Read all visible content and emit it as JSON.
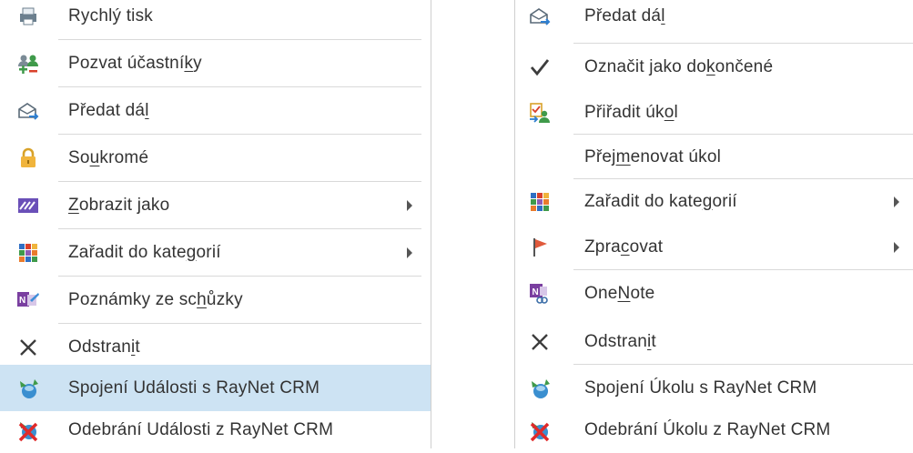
{
  "left_menu": {
    "items": [
      {
        "label_a": "Rychlý tisk",
        "icon": "printer-icon"
      },
      {
        "label_a": "Pozvat účastní",
        "label_u": "k",
        "label_b": "y",
        "icon": "invite-attendees-icon"
      },
      {
        "label_a": "Předat dá",
        "label_u": "l",
        "label_b": "",
        "icon": "forward-icon"
      },
      {
        "label_a": "So",
        "label_u": "u",
        "label_b": "kromé",
        "icon": "lock-icon"
      },
      {
        "label_a": "",
        "label_u": "Z",
        "label_b": "obrazit jako",
        "icon": "show-as-icon",
        "submenu": true
      },
      {
        "label_a": "Zařadit do kate",
        "label_u": "g",
        "label_b": "orií",
        "icon": "categorize-icon",
        "submenu": true
      },
      {
        "label_a": "Poznámky ze sc",
        "label_u": "h",
        "label_b": "ůzky",
        "icon": "onenote-meeting-notes-icon"
      },
      {
        "label_a": "Odstran",
        "label_u": "i",
        "label_b": "t",
        "icon": "delete-icon"
      },
      {
        "label_a": "Spojení Události s RayNet CRM",
        "icon": "raynet-link-icon",
        "highlight": true
      },
      {
        "label_a": "Odebrání Události z RayNet CRM",
        "icon": "raynet-unlink-icon"
      }
    ]
  },
  "right_menu": {
    "items": [
      {
        "label_a": "Předat dá",
        "label_u": "l",
        "label_b": "",
        "icon": "forward-icon"
      },
      {
        "label_a": "Označit jako do",
        "label_u": "k",
        "label_b": "ončené",
        "icon": "checkmark-icon"
      },
      {
        "label_a": "Přiřadit úk",
        "label_u": "o",
        "label_b": "l",
        "icon": "assign-task-icon"
      },
      {
        "label_a": "Přej",
        "label_u": "m",
        "label_b": "enovat úkol",
        "icon": ""
      },
      {
        "label_a": "Zařadit do kate",
        "label_u": "g",
        "label_b": "orií",
        "icon": "categorize-icon",
        "submenu": true
      },
      {
        "label_a": "Zpra",
        "label_u": "c",
        "label_b": "ovat",
        "icon": "flag-icon",
        "submenu": true
      },
      {
        "label_a": "One",
        "label_u": "N",
        "label_b": "ote",
        "icon": "onenote-icon"
      },
      {
        "label_a": "Odstran",
        "label_u": "i",
        "label_b": "t",
        "icon": "delete-icon"
      },
      {
        "label_a": "Spojení Úkolu s RayNet CRM",
        "icon": "raynet-link-icon"
      },
      {
        "label_a": "Odebrání Úkolu z RayNet CRM",
        "icon": "raynet-unlink-icon"
      }
    ]
  },
  "colors": {
    "highlight": "#cde3f3",
    "separator": "#d9d9d9",
    "text": "#333333"
  }
}
